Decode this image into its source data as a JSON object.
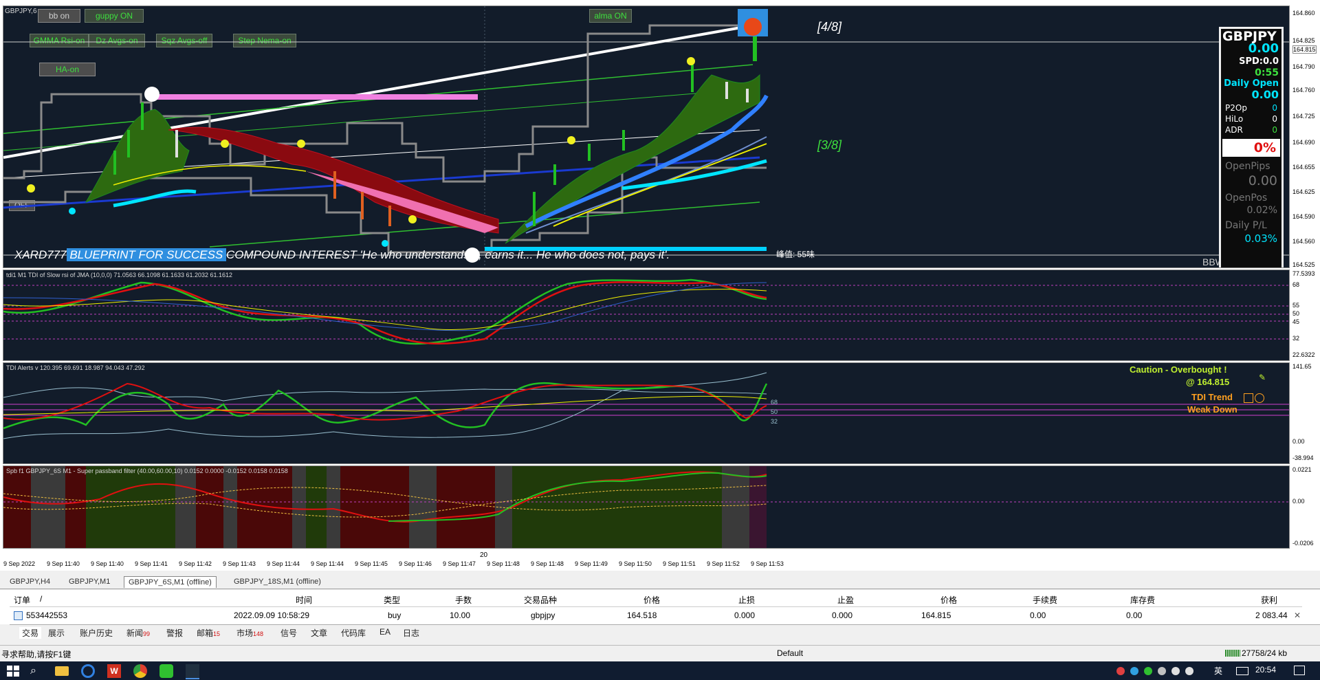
{
  "window": {
    "symbol_tab": "GBPJPY,6"
  },
  "toggles": {
    "bb": "bb on",
    "guppy": "guppy ON",
    "alma": "alma ON",
    "gmma": "GMMA Rsi-on",
    "dz": "Dz Avgs-on",
    "sqz": "Sqz Avgs-off",
    "step": "Step Nema-on",
    "ha": "HA-on",
    "off": "OFF"
  },
  "main_chart": {
    "murrey_top": "[4/8]",
    "murrey_mid": "[3/8]",
    "banner_left": "XARD777",
    "banner_blue": " BLUEPRINT FOR SUCCESS ",
    "banner_right": " COMPOUND INTEREST 'He who understands it, earns it... He who does not, pays it'.",
    "spread_note": "峰值: 55味",
    "bbw_label": "BBW",
    "price_axis": [
      "164.860",
      "164.825",
      "164.815",
      "164.790",
      "164.760",
      "164.725",
      "164.690",
      "164.655",
      "164.625",
      "164.590",
      "164.560",
      "164.525"
    ],
    "current_price": "164.815"
  },
  "info_panel": {
    "symbol": "GBPJPY",
    "value": "0.00",
    "spd_label": "SPD:",
    "spd": "0.0",
    "timer": "0:55",
    "daily_open_label": "Daily Open",
    "daily_open": "0.00",
    "p2op_label": "P2Op",
    "p2op": "0",
    "hilo_label": "HiLo",
    "hilo": "0",
    "adr_label": "ADR",
    "adr": "0",
    "percent": "0%",
    "openpips_label": "OpenPips",
    "openpips": "0.00",
    "openpos_label": "OpenPos",
    "openpos": "0.02%",
    "dailypl_label": "Daily P/L",
    "dailypl": "0.03%"
  },
  "pane_tdi1": {
    "title": "tdi1 M1 TDI of Slow rsi of JMA (10,0,0) 71.0563 66.1098 61.1633 61.2032 61.1612",
    "axis": [
      "77.5393",
      "68",
      "55",
      "50",
      "45",
      "32",
      "22.6322"
    ]
  },
  "pane_tdi2": {
    "title": "TDI Alerts v 120.395 69.691 18.987 94.043 47.292",
    "caution": "Caution - Overbought !",
    "at_price": "@ 164.815",
    "trend_label": "TDI Trend",
    "trend_value": "Weak Down",
    "levels": [
      "68",
      "50",
      "32"
    ],
    "axis": [
      "141.65",
      "0.00",
      "-38.994"
    ]
  },
  "pane_spb": {
    "title": "Spb f1 GBPJPY_6S M1 - Super passband filter (40.00,60.00,10) 0.0152 0.0000 -0.0152 0.0158 0.0158",
    "axis": [
      "0.0221",
      "0.00",
      "-0.0206"
    ]
  },
  "time_axis": [
    "9 Sep 2022",
    "9 Sep 11:40",
    "9 Sep 11:40",
    "9 Sep 11:41",
    "9 Sep 11:42",
    "9 Sep 11:43",
    "9 Sep 11:44",
    "9 Sep 11:44",
    "9 Sep 11:45",
    "9 Sep 11:46",
    "9 Sep 11:47",
    "9 Sep 11:48",
    "9 Sep 11:48",
    "9 Sep 11:49",
    "9 Sep 11:50",
    "9 Sep 11:51",
    "9 Sep 11:52",
    "9 Sep 11:53"
  ],
  "time_marker": "20",
  "chart_tabs": [
    "GBPJPY,H4",
    "GBPJPY,M1",
    "GBPJPY_6S,M1 (offline)",
    "GBPJPY_18S,M1 (offline)"
  ],
  "terminal": {
    "headers": [
      "订单",
      "/",
      "时间",
      "类型",
      "手数",
      "交易品种",
      "价格",
      "止损",
      "止盈",
      "价格",
      "手续费",
      "库存费",
      "获利"
    ],
    "row": [
      "553442553",
      "2022.09.09 10:58:29",
      "buy",
      "10.00",
      "gbpjpy",
      "164.518",
      "0.000",
      "0.000",
      "164.815",
      "0.00",
      "0.00",
      "2 083.44"
    ]
  },
  "bottom_tabs": [
    {
      "label": "交易",
      "badge": ""
    },
    {
      "label": "展示",
      "badge": ""
    },
    {
      "label": "账户历史",
      "badge": ""
    },
    {
      "label": "新闻",
      "badge": "99"
    },
    {
      "label": "警报",
      "badge": ""
    },
    {
      "label": "邮箱",
      "badge": "15"
    },
    {
      "label": "市场",
      "badge": "148"
    },
    {
      "label": "信号",
      "badge": ""
    },
    {
      "label": "文章",
      "badge": ""
    },
    {
      "label": "代码库",
      "badge": ""
    },
    {
      "label": "EA",
      "badge": ""
    },
    {
      "label": "日志",
      "badge": ""
    }
  ],
  "status": {
    "help": "寻求帮助,请按F1键",
    "profile": "Default",
    "traffic": "27758/24 kb"
  },
  "taskbar": {
    "time": "20:54",
    "lang": "英"
  },
  "colors": {
    "bg": "#121c2a",
    "green": "#22c022",
    "red": "#e01010",
    "cyan": "#00e5ff",
    "magenta": "#c040c0"
  }
}
